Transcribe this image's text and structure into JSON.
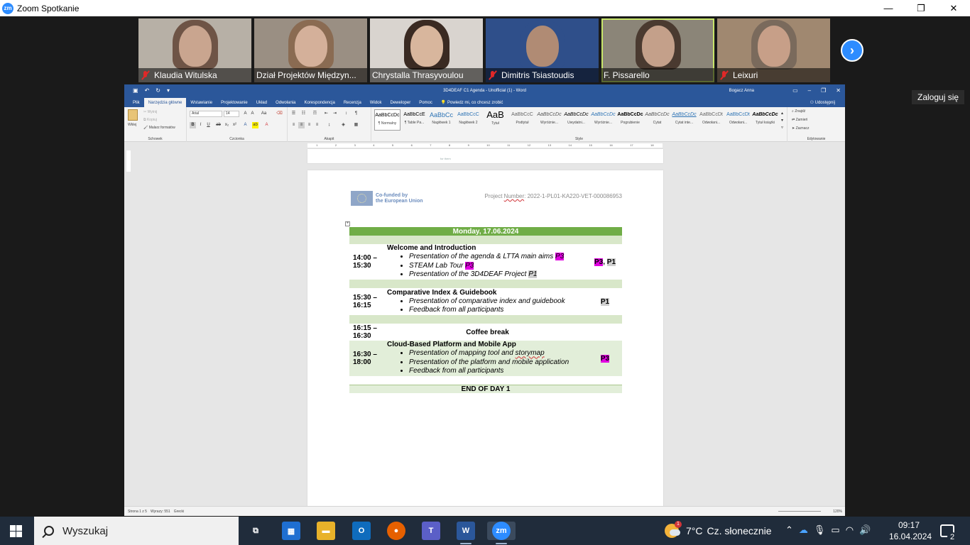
{
  "zoom": {
    "logo_text": "zm",
    "window_title": "Zoom Spotkanie",
    "login_label": "Zaloguj się",
    "next_arrow": "›",
    "participants": [
      {
        "name": "Klaudia Witulska",
        "muted": true
      },
      {
        "name": "Dział Projektów Międzyn...",
        "muted": false
      },
      {
        "name": "Chrystalla Thrasyvoulou",
        "muted": false
      },
      {
        "name": "Dimitris Tsiastoudis",
        "muted": true
      },
      {
        "name": "F. Pissarello",
        "muted": false,
        "active": true
      },
      {
        "name": "Leixuri",
        "muted": true
      }
    ]
  },
  "word": {
    "title": "3D4DEAF C1 Agenda - Unofficial (1) - Word",
    "user": "Bogacz Anna",
    "tabs": [
      "Plik",
      "Narzędzia główne",
      "Wstawianie",
      "Projektowanie",
      "Układ",
      "Odwołania",
      "Korespondencja",
      "Recenzja",
      "Widok",
      "Deweloper",
      "Pomoc"
    ],
    "tell_me": "Powiedz mi, co chcesz zrobić",
    "share": "Udostępnij",
    "clipboard": {
      "paste": "Wklej",
      "cut": "Wytnij",
      "copy": "Kopiuj",
      "painter": "Malarz formatów",
      "label": "Schowek"
    },
    "font": {
      "name": "Arial",
      "size": "14",
      "label": "Czcionka"
    },
    "paragraph_label": "Akapit",
    "styles_label": "Style",
    "styles": [
      {
        "sample": "AaBbCcDc",
        "name": "¶ Normalny"
      },
      {
        "sample": "AaBbCcE",
        "name": "¶ Table Pa..."
      },
      {
        "sample": "AaBbCc",
        "name": "Nagłówek 1"
      },
      {
        "sample": "AaBbCcC",
        "name": "Nagłówek 2"
      },
      {
        "sample": "AaB",
        "name": "Tytuł"
      },
      {
        "sample": "AaBbCcC",
        "name": "Podtytuł"
      },
      {
        "sample": "AaBbCcDc",
        "name": "Wyróżnie..."
      },
      {
        "sample": "AaBbCcDc",
        "name": "Uwydatni..."
      },
      {
        "sample": "AaBbCcDc",
        "name": "Wyróżnie..."
      },
      {
        "sample": "AaBbCcDc",
        "name": "Pogrubienie"
      },
      {
        "sample": "AaBbCcDc",
        "name": "Cytat"
      },
      {
        "sample": "AaBbCcDc",
        "name": "Cytat inte..."
      },
      {
        "sample": "AaBbCcDt",
        "name": "Odwołani..."
      },
      {
        "sample": "AaBbCcDt",
        "name": "Odwołani..."
      },
      {
        "sample": "AaBbCcDc",
        "name": "Tytuł książki"
      }
    ],
    "editing": {
      "find": "Znajdź",
      "replace": "Zamień",
      "select": "Zaznacz",
      "label": "Edytowanie"
    },
    "prev_page_text": "for them",
    "eu_text_line1": "Co-funded by",
    "eu_text_line2": "the European Union",
    "project_label": "Project",
    "project_number_word": "Number",
    "project_number": ": 2022-1-PL01-KA220-VET-000086953",
    "agenda": {
      "header": "Monday, 17.06.2024",
      "sessions": [
        {
          "time_line1": "14:00 –",
          "time_line2": "15:30",
          "title": "Welcome and Introduction",
          "items": [
            {
              "text": "Presentation of the agenda & LTTA main aims ",
              "tag": "P3",
              "tag_style": "mag"
            },
            {
              "text": "STEAM Lab Tour ",
              "tag": "P3",
              "tag_style": "mag"
            },
            {
              "text": "Presentation of the 3D4DEAF Project ",
              "tag": "P1",
              "tag_style": "gray"
            }
          ],
          "who_a": "P3",
          "who_sep": ", ",
          "who_b": "P1"
        },
        {
          "time_line1": "15:30 –",
          "time_line2": "16:15",
          "title": "Comparative Index & Guidebook",
          "items": [
            {
              "text": "Presentation of comparative index and guidebook"
            },
            {
              "text": "Feedback from all participants"
            }
          ],
          "who_a": "P1"
        },
        {
          "time_line1": "16:15 –",
          "time_line2": "16:30",
          "break_label": "Coffee break"
        },
        {
          "time_line1": "16:30 –",
          "time_line2": "18:00",
          "title": "Cloud-Based Platform and Mobile App",
          "items": [
            {
              "text_a": "Presentation of mapping tool and ",
              "text_b": "storymap"
            },
            {
              "text": "Presentation of the platform and mobile application"
            },
            {
              "text": "Feedback from all participants"
            }
          ],
          "who_a": "P3"
        }
      ],
      "end": "END OF DAY 1"
    },
    "status": {
      "page": "Strona 1 z 5",
      "words": "Wyrazy: 551",
      "lang": "Grecki",
      "zoom": "120%"
    }
  },
  "taskbar": {
    "search_placeholder": "Wyszukaj",
    "weather_badge": "1",
    "weather_temp": "7°C",
    "weather_desc": "Cz. słonecznie",
    "time": "09:17",
    "date": "16.04.2024",
    "notifications": "2",
    "apps": [
      {
        "name": "task-view",
        "label": "⧉"
      },
      {
        "name": "store",
        "label": "▦"
      },
      {
        "name": "file-explorer",
        "label": "▬"
      },
      {
        "name": "outlook",
        "label": "O"
      },
      {
        "name": "firefox",
        "label": "●"
      },
      {
        "name": "teams",
        "label": "T"
      },
      {
        "name": "word",
        "label": "W"
      },
      {
        "name": "zoom",
        "label": "zm"
      }
    ]
  }
}
